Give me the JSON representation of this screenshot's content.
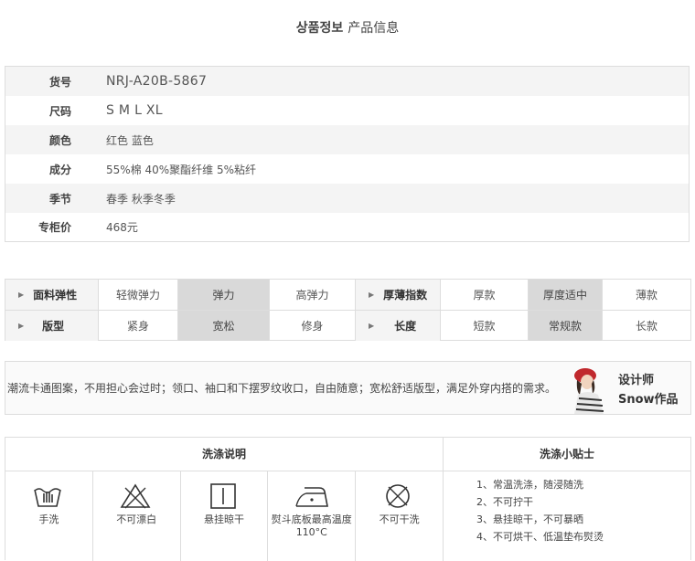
{
  "page": {
    "title_ko": "상품정보",
    "title_cn": "产品信息"
  },
  "info": [
    {
      "label": "货号",
      "value": "NRJ-A20B-5867"
    },
    {
      "label": "尺码",
      "value": "S M L XL"
    },
    {
      "label": "颜色",
      "value": "红色 蓝色"
    },
    {
      "label": "成分",
      "value": "55%棉 40%聚酯纤维 5%粘纤"
    },
    {
      "label": "季节",
      "value": "春季 秋季冬季"
    },
    {
      "label": "专柜价",
      "value": "468元"
    }
  ],
  "attributes": {
    "fabric_elasticity": {
      "label": "面料弹性",
      "options": [
        "轻微弹力",
        "弹力",
        "高弹力"
      ],
      "selected": "弹力"
    },
    "thickness": {
      "label": "厚薄指数",
      "options": [
        "厚款",
        "厚度适中",
        "薄款"
      ],
      "selected": "厚度适中"
    },
    "fit": {
      "label": "版型",
      "options": [
        "紧身",
        "宽松",
        "修身"
      ],
      "selected": "宽松"
    },
    "length": {
      "label": "长度",
      "options": [
        "短款",
        "常规款",
        "长款"
      ],
      "selected": "常规款"
    }
  },
  "description": {
    "text": "潮流卡通图案，不用担心会过时；领口、袖口和下摆罗纹收口，自由随意；宽松舒适版型，满足外穿内搭的需求。",
    "designer": "设计师Snow作品"
  },
  "wash": {
    "instructions_title": "洗涤说明",
    "tips_title": "洗涤小贴士",
    "icons": [
      {
        "icon": "hand-wash-icon",
        "caption": "手洗"
      },
      {
        "icon": "no-bleach-icon",
        "caption": "不可漂白"
      },
      {
        "icon": "hang-dry-icon",
        "caption": "悬挂晾干"
      },
      {
        "icon": "iron-icon",
        "caption": "熨斗底板最高温度110°C"
      },
      {
        "icon": "no-dry-clean-icon",
        "caption": "不可干洗"
      }
    ],
    "tips": [
      "1、常温洗涤，随浸随洗",
      "2、不可拧干",
      "3、悬挂晾干，不可暴晒",
      "4、不可烘干、低温垫布熨烫"
    ]
  },
  "colors": {
    "selected_cell": "#d9d9d9",
    "row_alt": "#f4f4f4",
    "border": "#dddddd"
  }
}
